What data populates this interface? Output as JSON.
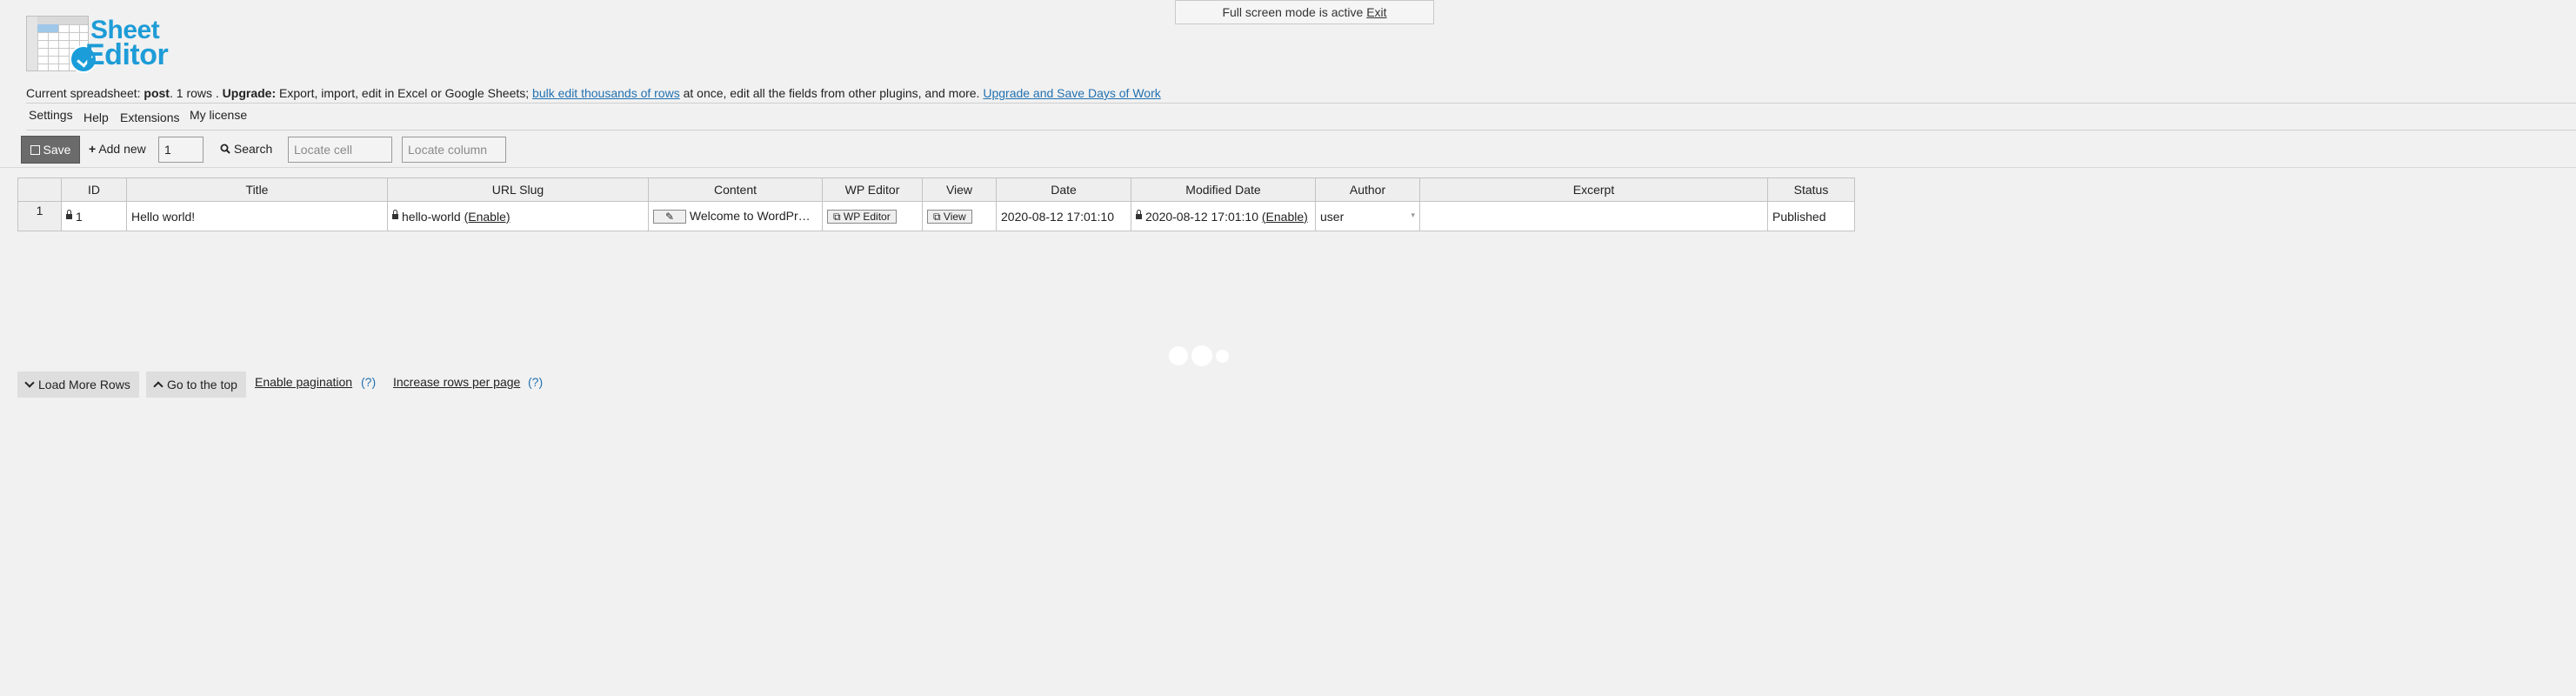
{
  "fullscreen": {
    "text": "Full screen mode is active",
    "exit": "Exit"
  },
  "logo": {
    "line1": "Sheet",
    "line2": "Editor"
  },
  "info": {
    "prefix": "Current spreadsheet:",
    "post_type": "post",
    "rows": ". 1 rows .",
    "upgrade_label": "Upgrade:",
    "text1": "Export, import, edit in Excel or Google Sheets;",
    "link1": "bulk edit thousands of rows",
    "text2": "at once, edit all the fields from other plugins, and more.",
    "link2": "Upgrade and Save Days of Work"
  },
  "menu": [
    "Settings",
    "Help",
    "Extensions",
    "My license"
  ],
  "toolbar": {
    "save": "Save",
    "add_new": "Add new",
    "add_count": "1",
    "search": "Search",
    "locate_cell": "Locate cell",
    "locate_column": "Locate column"
  },
  "table": {
    "columns": [
      "ID",
      "Title",
      "URL Slug",
      "Content",
      "WP Editor",
      "View",
      "Date",
      "Modified Date",
      "Author",
      "Excerpt",
      "Status"
    ],
    "row": {
      "num": "1",
      "id": "1",
      "title": "Hello world!",
      "slug": "hello-world",
      "enable": "(Enable)",
      "content": "Welcome to WordPr…",
      "wp_editor": "WP Editor",
      "view": "View",
      "date": "2020-08-12 17:01:10",
      "modified": "2020-08-12 17:01:10",
      "author": "user",
      "excerpt": "",
      "status": "Published"
    }
  },
  "bottom": {
    "load_more": "Load More Rows",
    "go_top": "Go to the top",
    "enable_pagination": "Enable pagination",
    "q1": "(?)",
    "increase_rows": "Increase rows per page",
    "q2": "(?)"
  }
}
